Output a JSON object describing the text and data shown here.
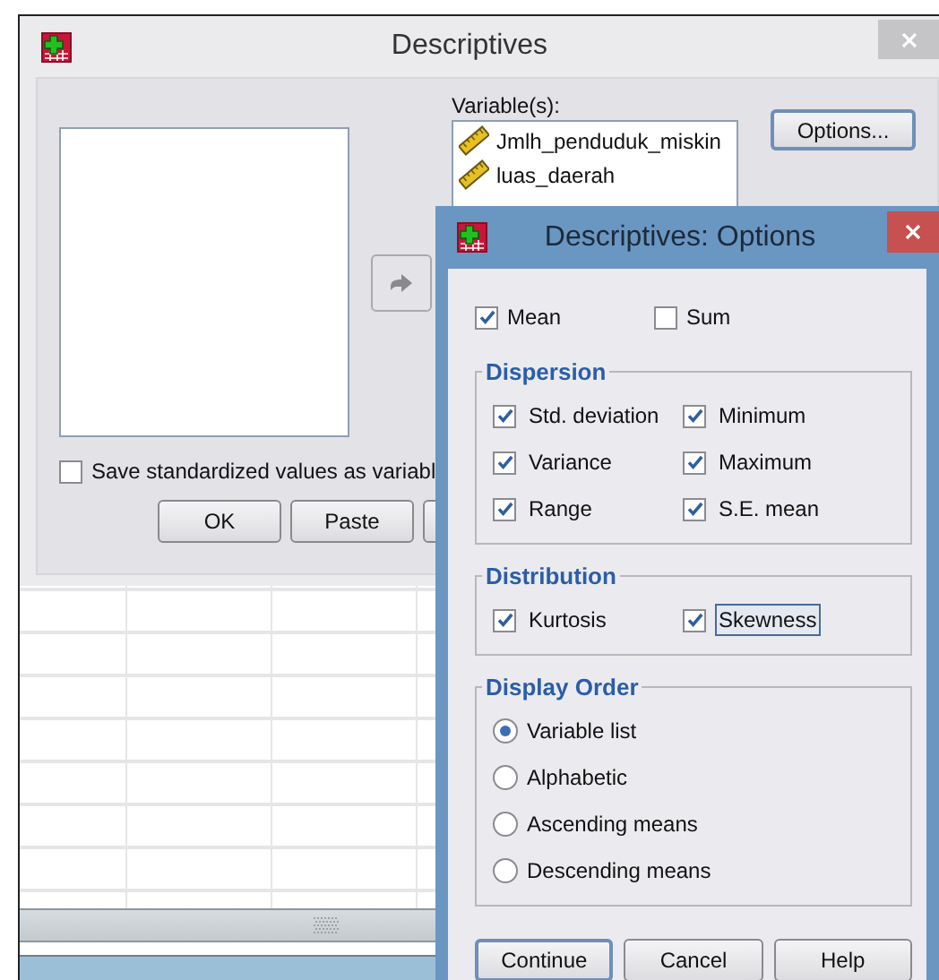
{
  "main_dialog": {
    "title": "Descriptives",
    "variables_label": "Variable(s):",
    "variables": [
      "Jmlh_penduduk_miskin",
      "luas_daerah"
    ],
    "options_button": {
      "label": "Options...",
      "default": true
    },
    "save_checkbox": {
      "label": "Save standardized values as variabl",
      "checked": false
    },
    "buttons": [
      {
        "label": "OK",
        "default": false
      },
      {
        "label": "Paste",
        "default": false
      }
    ]
  },
  "options_dialog": {
    "title": "Descriptives: Options",
    "top_options": [
      {
        "label": "Mean",
        "checked": true
      },
      {
        "label": "Sum",
        "checked": false
      }
    ],
    "groups": [
      {
        "title": "Dispersion",
        "kind": "checkbox",
        "items": [
          {
            "label": "Std. deviation",
            "checked": true,
            "focused": false
          },
          {
            "label": "Minimum",
            "checked": true,
            "focused": false
          },
          {
            "label": "Variance",
            "checked": true,
            "focused": false
          },
          {
            "label": "Maximum",
            "checked": true,
            "focused": false
          },
          {
            "label": "Range",
            "checked": true,
            "focused": false
          },
          {
            "label": "S.E. mean",
            "checked": true,
            "focused": false
          }
        ]
      },
      {
        "title": "Distribution",
        "kind": "checkbox",
        "items": [
          {
            "label": "Kurtosis",
            "checked": true,
            "focused": false
          },
          {
            "label": "Skewness",
            "checked": true,
            "focused": true
          }
        ]
      },
      {
        "title": "Display Order",
        "kind": "radio",
        "items": [
          {
            "label": "Variable list",
            "selected": true
          },
          {
            "label": "Alphabetic",
            "selected": false
          },
          {
            "label": "Ascending means",
            "selected": false
          },
          {
            "label": "Descending means",
            "selected": false
          }
        ]
      }
    ],
    "buttons": [
      {
        "label": "Continue",
        "default": true
      },
      {
        "label": "Cancel",
        "default": false
      },
      {
        "label": "Help",
        "default": false
      }
    ]
  }
}
